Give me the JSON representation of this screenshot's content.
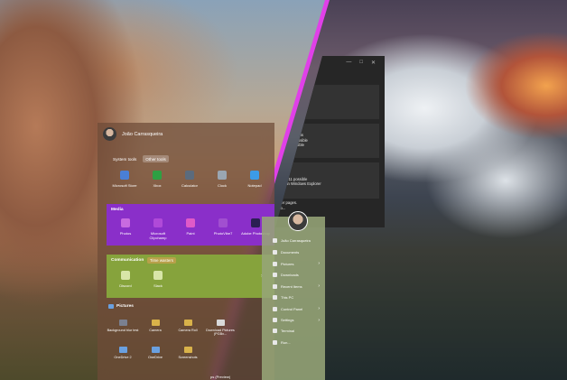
{
  "user": {
    "name": "João Carrasqueira"
  },
  "tabs": [
    {
      "label": "System tools",
      "active": false
    },
    {
      "label": "Other tools",
      "active": true
    }
  ],
  "system_tools": [
    {
      "label": "Microsoft Store",
      "icon": "store-icon",
      "color": "#4a7fd6"
    },
    {
      "label": "Xbox",
      "icon": "xbox-icon",
      "color": "#2ea043"
    },
    {
      "label": "Calculator",
      "icon": "calculator-icon",
      "color": "#5b6b7d"
    },
    {
      "label": "Clock",
      "icon": "clock-icon",
      "color": "#9aa6b2"
    },
    {
      "label": "Notepad",
      "icon": "notepad-icon",
      "color": "#3c9be6"
    }
  ],
  "media": {
    "title": "Media",
    "color": "#8a2fc9",
    "items": [
      {
        "label": "Photos",
        "icon": "photos-icon",
        "color": "#c86be0"
      },
      {
        "label": "Microsoft Clipchamp",
        "icon": "clipchamp-icon",
        "color": "#b04ad8"
      },
      {
        "label": "Paint",
        "icon": "paint-icon",
        "color": "#e05ac8"
      },
      {
        "label": "PhotoVibe7",
        "icon": "photovibe-icon",
        "color": "#a14fd0"
      },
      {
        "label": "Adobe Photoshop",
        "icon": "photoshop-icon",
        "color": "#2b1f52"
      }
    ]
  },
  "communication": {
    "title": "Communication",
    "badge": "Time wasters",
    "color": "#86a33c",
    "items": [
      {
        "label": "Discord",
        "icon": "discord-icon",
        "color": "#d8e6a8"
      },
      {
        "label": "Slack",
        "icon": "slack-icon",
        "color": "#d8e6a8"
      }
    ]
  },
  "pictures": {
    "title": "Pictures",
    "items": [
      {
        "label": "Background blur test",
        "color": "#7a8090"
      },
      {
        "label": "Camera",
        "color": "#d9b24a"
      },
      {
        "label": "Camera Roll",
        "color": "#d9b24a"
      },
      {
        "label": "Download Pictures (PGBx...",
        "color": "#d9d9d9"
      },
      {
        "label": "OneDrive 2",
        "color": "#6aa0e0"
      },
      {
        "label": "OneDrive",
        "color": "#6aa0e0"
      },
      {
        "label": "Screenshots",
        "color": "#d9b24a"
      }
    ],
    "extra_label": "ps (Preview)"
  },
  "settings_window": {
    "controls": [
      "—",
      "□",
      "✕"
    ],
    "cards": [
      {
        "lines": [
          "elements",
          "if possible",
          "plorer"
        ]
      },
      {
        "lines": [
          "elements",
          "s if possible",
          "r possible"
        ]
      },
      {
        "lines": [
          "bar style",
          "f Windows 11 possible",
          "rs bottom in Windows Explorer"
        ]
      }
    ],
    "footer_lines": [
      "ately on other pages.",
      "ze and choo..."
    ]
  },
  "light_menu": {
    "items": [
      {
        "label": "João Carrasqueira",
        "icon": "user-icon",
        "chevron": false
      },
      {
        "label": "Documents",
        "icon": "documents-icon",
        "chevron": false
      },
      {
        "label": "Pictures",
        "icon": "pictures-icon",
        "chevron": true
      },
      {
        "label": "Downloads",
        "icon": "downloads-icon",
        "chevron": false
      },
      {
        "label": "Recent Items",
        "icon": "recent-icon",
        "chevron": true
      },
      {
        "label": "This PC",
        "icon": "pc-icon",
        "chevron": false
      },
      {
        "label": "Control Panel",
        "icon": "control-panel-icon",
        "chevron": true
      },
      {
        "label": "Settings",
        "icon": "gear-icon",
        "chevron": true
      },
      {
        "label": "Terminal",
        "icon": "terminal-icon",
        "chevron": false
      },
      {
        "label": "Run...",
        "icon": "run-icon",
        "chevron": false
      }
    ]
  }
}
